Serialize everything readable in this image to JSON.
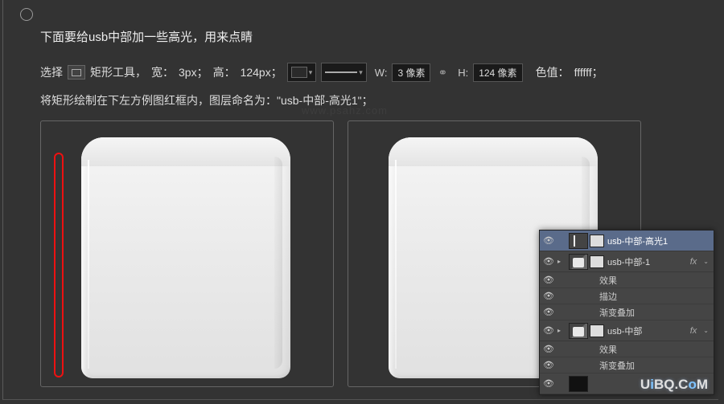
{
  "title": "下面要给usb中部加一些高光，用来点睛",
  "row2": {
    "select": "选择",
    "toolname": "矩形工具，",
    "width_lbl": "宽：",
    "width_val": "3px；",
    "height_lbl": "高：",
    "height_val": "124px；",
    "w": "W:",
    "w_input": "3 像素",
    "h": "H:",
    "h_input": "124 像素",
    "color_lbl": "色值：",
    "color_val": "ffffff；"
  },
  "row3": "将矩形绘制在下左方例图红框内，图层命名为：\"usb-中部-高光1\"；",
  "layers": {
    "l1": "usb-中部-高光1",
    "l2": "usb-中部-1",
    "fx": "fx",
    "effects": "效果",
    "stroke": "描边",
    "gradient": "渐变叠加",
    "l3": "usb-中部"
  },
  "watermark": "www.psahz.com",
  "logo_a": "U",
  "logo_b": "i",
  "logo_c": "BQ.C",
  "logo_d": "o",
  "logo_e": "M"
}
